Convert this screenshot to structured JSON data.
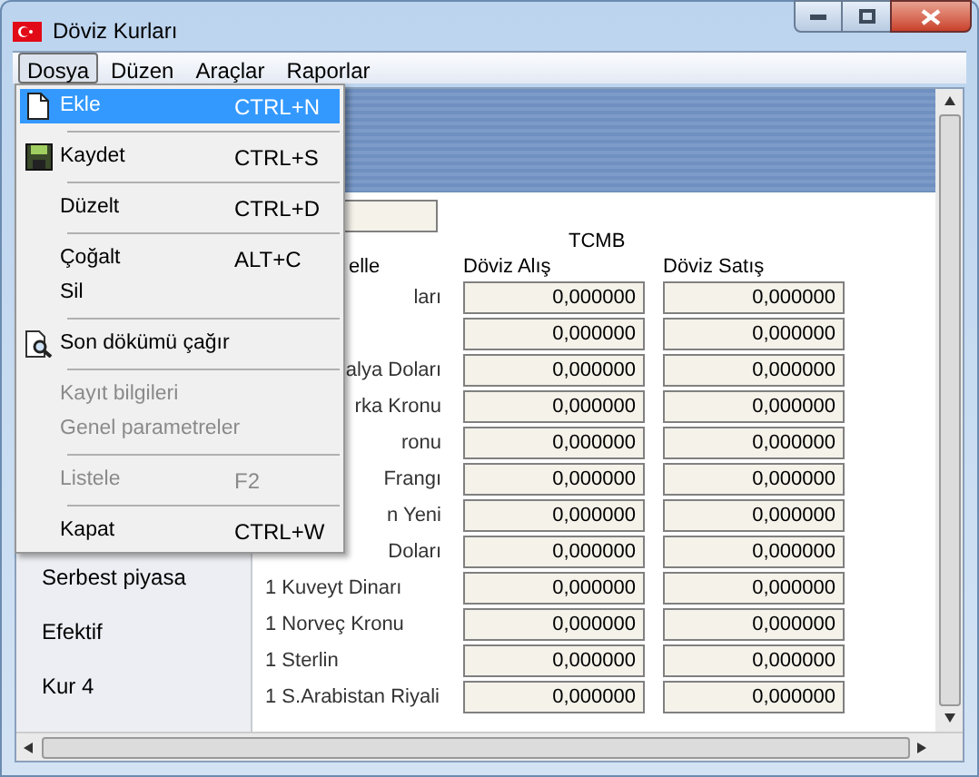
{
  "window": {
    "title": "Döviz Kurları"
  },
  "menubar": [
    {
      "label": "Dosya",
      "selected": true
    },
    {
      "label": "Düzen",
      "selected": false
    },
    {
      "label": "Araçlar",
      "selected": false
    },
    {
      "label": "Raporlar",
      "selected": false
    }
  ],
  "menu": [
    {
      "kind": "item",
      "label": "Ekle",
      "shortcut": "CTRL+N",
      "selected": true,
      "disabled": false
    },
    {
      "kind": "separator"
    },
    {
      "kind": "item",
      "label": "Kaydet",
      "shortcut": "CTRL+S",
      "selected": false,
      "disabled": false
    },
    {
      "kind": "separator"
    },
    {
      "kind": "item",
      "label": "Düzelt",
      "shortcut": "CTRL+D",
      "selected": false,
      "disabled": false
    },
    {
      "kind": "separator"
    },
    {
      "kind": "item",
      "label": "Çoğalt",
      "shortcut": "ALT+C",
      "selected": false,
      "disabled": false
    },
    {
      "kind": "item",
      "label": "Sil",
      "selected": false,
      "disabled": false
    },
    {
      "kind": "separator"
    },
    {
      "kind": "item",
      "label": "Son dökümü çağır",
      "selected": false,
      "disabled": false
    },
    {
      "kind": "separator"
    },
    {
      "kind": "item",
      "label": "Kayıt bilgileri",
      "selected": false,
      "disabled": true
    },
    {
      "kind": "item",
      "label": "Genel parametreler",
      "selected": false,
      "disabled": true
    },
    {
      "kind": "separator"
    },
    {
      "kind": "item",
      "label": "Listele",
      "shortcut": "F2",
      "selected": false,
      "disabled": true
    },
    {
      "kind": "separator"
    },
    {
      "kind": "item",
      "label": "Kapat",
      "shortcut": "CTRL+W",
      "selected": false,
      "disabled": false
    }
  ],
  "sources": [
    {
      "label": "Serbest piyasa"
    },
    {
      "label": "Efektif"
    },
    {
      "label": "Kur 4"
    }
  ],
  "rates": {
    "group_title": "TCMB",
    "columns": [
      "elle",
      "Döviz Alış",
      "Döviz Satış"
    ],
    "rows": [
      {
        "label": "ları",
        "buy": "0,000000",
        "sell": "0,000000"
      },
      {
        "buy": "0,000000",
        "sell": "0,000000"
      },
      {
        "label": "alya Doları",
        "buy": "0,000000",
        "sell": "0,000000"
      },
      {
        "label": "rka Kronu",
        "buy": "0,000000",
        "sell": "0,000000"
      },
      {
        "label": "ronu",
        "buy": "0,000000",
        "sell": "0,000000"
      },
      {
        "label": "Frangı",
        "buy": "0,000000",
        "sell": "0,000000"
      },
      {
        "label": "n Yeni",
        "buy": "0,000000",
        "sell": "0,000000"
      },
      {
        "label": "Doları",
        "buy": "0,000000",
        "sell": "0,000000"
      },
      {
        "label": "1 Kuveyt Dinarı",
        "buy": "0,000000",
        "sell": "0,000000"
      },
      {
        "label": "1 Norveç Kronu",
        "buy": "0,000000",
        "sell": "0,000000"
      },
      {
        "label": "1 Sterlin",
        "buy": "0,000000",
        "sell": "0,000000"
      },
      {
        "label": "1 S.Arabistan Riyali",
        "buy": "0,000000",
        "sell": "0,000000"
      }
    ]
  }
}
